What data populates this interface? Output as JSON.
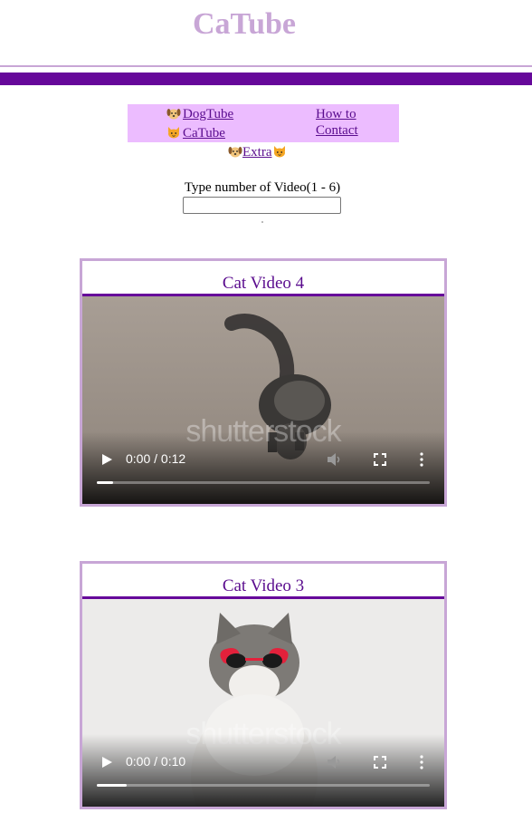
{
  "header": {
    "title": "CaTube"
  },
  "colors": {
    "title": "#c8a6d6",
    "bar": "#66089a",
    "nav_background": "#ecbcff",
    "link": "#5a0c8e"
  },
  "nav": {
    "dogtube": {
      "label": "DogTube",
      "icon": "dog-face-icon"
    },
    "catube": {
      "label": "CaTube",
      "icon": "cat-face-icon"
    },
    "how_to": "How to",
    "contact": "Contact",
    "extra": {
      "label": "Extra",
      "icons": [
        "dog-face-icon",
        "cat-face-icon"
      ]
    }
  },
  "search": {
    "label": "Type number of Video(1 - 6)",
    "value": ""
  },
  "videos": [
    {
      "title": "Cat Video 4",
      "time": "0:00 / 0:12",
      "progress": 0.05,
      "watermark": "shutterstock"
    },
    {
      "title": "Cat Video 3",
      "time": "0:00 / 0:10",
      "progress": 0.09,
      "watermark": "shutterstock"
    }
  ]
}
